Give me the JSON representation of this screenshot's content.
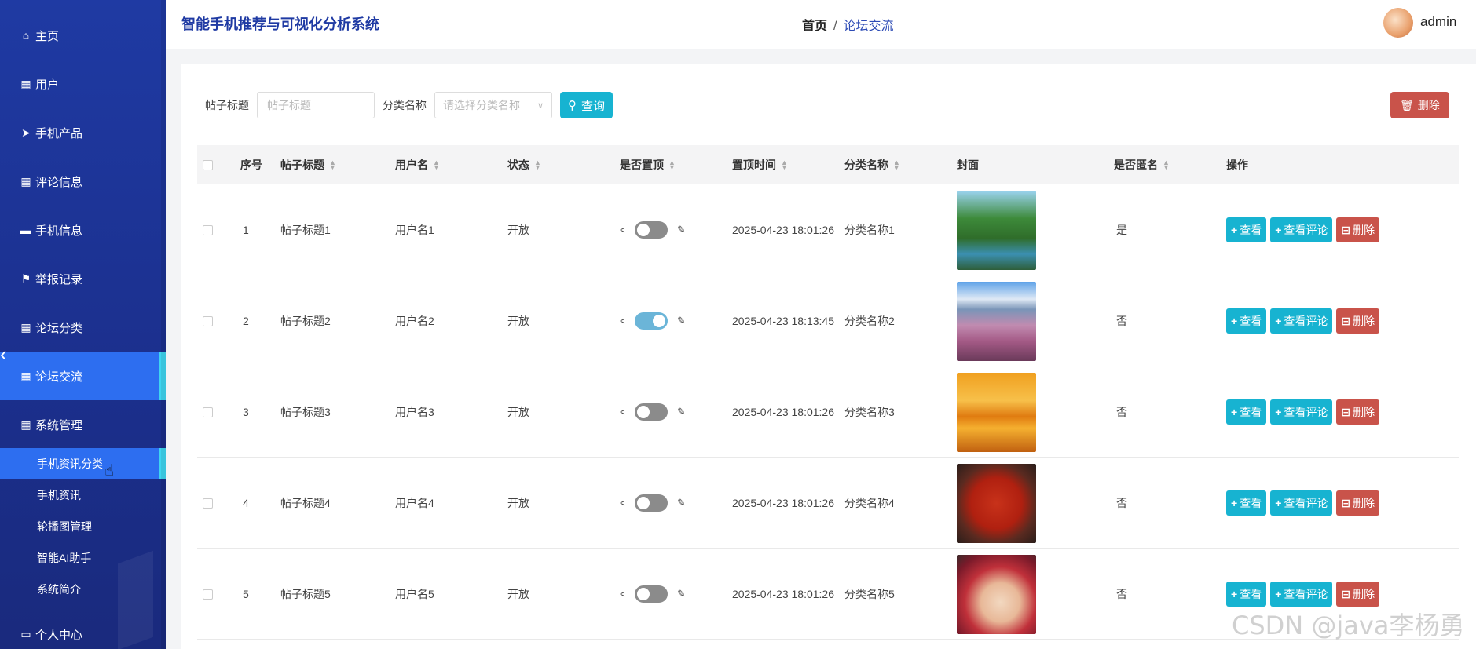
{
  "header": {
    "app_title": "智能手机推荐与可视化分析系统",
    "breadcrumb_home": "首页",
    "breadcrumb_sep": "/",
    "breadcrumb_current": "论坛交流",
    "username": "admin"
  },
  "sidebar": {
    "items": [
      {
        "label": "主页",
        "icon": "home-icon"
      },
      {
        "label": "用户",
        "icon": "grid-icon"
      },
      {
        "label": "手机产品",
        "icon": "paper-plane-icon"
      },
      {
        "label": "评论信息",
        "icon": "grid-icon"
      },
      {
        "label": "手机信息",
        "icon": "comment-icon"
      },
      {
        "label": "举报记录",
        "icon": "flag-icon"
      },
      {
        "label": "论坛分类",
        "icon": "grid-icon"
      },
      {
        "label": "论坛交流",
        "icon": "grid-icon"
      },
      {
        "label": "系统管理",
        "icon": "grid-icon"
      }
    ],
    "sub_items": [
      {
        "label": "手机资讯分类"
      },
      {
        "label": "手机资讯"
      },
      {
        "label": "轮播图管理"
      },
      {
        "label": "智能AI助手"
      },
      {
        "label": "系统简介"
      }
    ],
    "personal": {
      "label": "个人中心",
      "icon": "card-icon"
    }
  },
  "search": {
    "title_label": "帖子标题",
    "title_placeholder": "帖子标题",
    "category_label": "分类名称",
    "category_placeholder": "请选择分类名称",
    "query_label": "查询",
    "delete_label": "删除"
  },
  "table": {
    "headers": {
      "index": "序号",
      "title": "帖子标题",
      "user": "用户名",
      "status": "状态",
      "pinned": "是否置顶",
      "pin_time": "置顶时间",
      "category": "分类名称",
      "cover": "封面",
      "anonymous": "是否匿名",
      "actions": "操作"
    },
    "actions": {
      "view": "查看",
      "view_comments": "查看评论",
      "delete": "删除"
    },
    "rows": [
      {
        "index": "1",
        "title": "帖子标题1",
        "user": "用户名1",
        "status": "开放",
        "pinned": false,
        "pin_time": "2025-04-23 18:01:26",
        "category": "分类名称1",
        "cover": "forest-river",
        "anonymous": "是"
      },
      {
        "index": "2",
        "title": "帖子标题2",
        "user": "用户名2",
        "status": "开放",
        "pinned": true,
        "pin_time": "2025-04-23 18:13:45",
        "category": "分类名称2",
        "cover": "mountain-blossom",
        "anonymous": "否"
      },
      {
        "index": "3",
        "title": "帖子标题3",
        "user": "用户名3",
        "status": "开放",
        "pinned": false,
        "pin_time": "2025-04-23 18:01:26",
        "category": "分类名称3",
        "cover": "sunset-lake",
        "anonymous": "否"
      },
      {
        "index": "4",
        "title": "帖子标题4",
        "user": "用户名4",
        "status": "开放",
        "pinned": false,
        "pin_time": "2025-04-23 18:01:26",
        "category": "分类名称4",
        "cover": "crayfish-dish",
        "anonymous": "否"
      },
      {
        "index": "5",
        "title": "帖子标题5",
        "user": "用户名5",
        "status": "开放",
        "pinned": false,
        "pin_time": "2025-04-23 18:01:26",
        "category": "分类名称5",
        "cover": "berry-cake",
        "anonymous": "否"
      }
    ]
  },
  "watermark": "CSDN @java李杨勇",
  "colors": {
    "sidebar": "#1f3aa3",
    "active": "#2d6ef0",
    "accent": "#17b3d1",
    "danger": "#c9534a"
  }
}
